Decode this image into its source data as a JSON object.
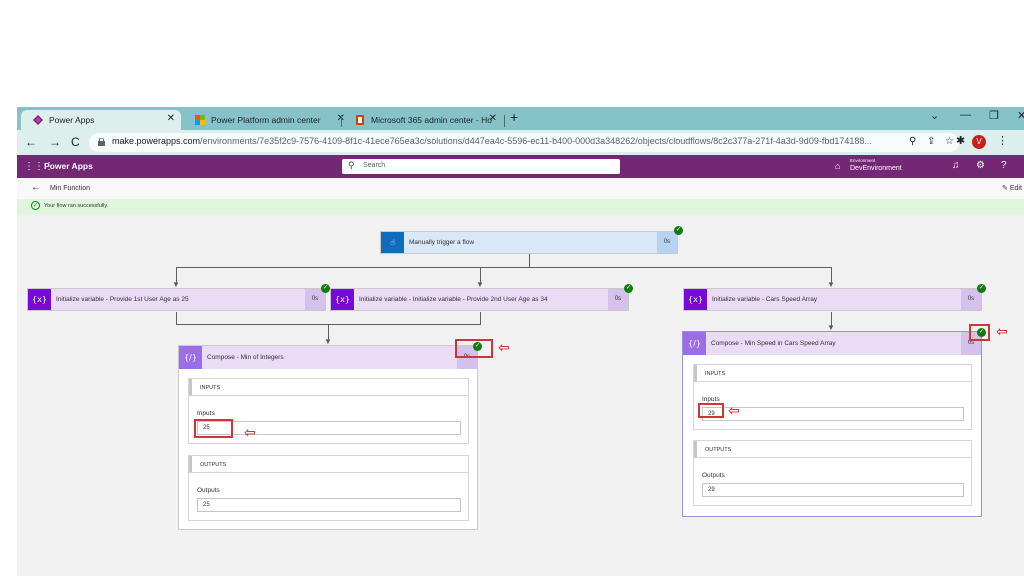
{
  "browser": {
    "tabs": [
      {
        "label": "Power Apps",
        "active": true
      },
      {
        "label": "Power Platform admin center",
        "active": false
      },
      {
        "label": "Microsoft 365 admin center - Ho",
        "active": false
      }
    ],
    "new_tab_icon": "plus-icon",
    "url_host": "make.powerapps.com",
    "url_path": "/environments/7e35f2c9-7576-4109-8f1c-41ece765ea3c/solutions/d447ea4c-5596-ec11-b400-000d3a348262/objects/cloudflows/8c2c377a-271f-4a3d-9d09-fbd174188...",
    "profile_initial": "V"
  },
  "app_header": {
    "title": "Power Apps",
    "search_placeholder": "Search",
    "environment_label": "Environment",
    "environment_name": "DevEnvironment"
  },
  "command_bar": {
    "flow_name": "Min Function",
    "edit_label": "Edit"
  },
  "banner": {
    "message": "Your flow ran successfully."
  },
  "flow": {
    "trigger": {
      "label": "Manually trigger a flow",
      "duration": "0s"
    },
    "variables": [
      {
        "icon": "{x}",
        "label": "Initialize variable - Provide 1st User Age as 25",
        "duration": "0s"
      },
      {
        "icon": "{x}",
        "label": "Initialize variable - Initialize variable - Provide 2nd User Age as 34",
        "duration": "0s"
      },
      {
        "icon": "{x}",
        "label": "Initialize variable - Cars Speed Array",
        "duration": "0s"
      }
    ],
    "compose_left": {
      "icon": "{/}",
      "label": "Compose - Min of Integers",
      "duration": "0s",
      "inputs_header": "INPUTS",
      "inputs_label": "Inputs",
      "inputs_value": "25",
      "outputs_header": "OUTPUTS",
      "outputs_label": "Outputs",
      "outputs_value": "25"
    },
    "compose_right": {
      "icon": "{/}",
      "label": "Compose - Min Speed in Cars Speed Array",
      "duration": "0s",
      "inputs_header": "INPUTS",
      "inputs_label": "Inputs",
      "inputs_value": "29",
      "outputs_header": "OUTPUTS",
      "outputs_label": "Outputs",
      "outputs_value": "29"
    }
  },
  "colors": {
    "app_header": "#742774",
    "variable_icon": "#770bd6",
    "trigger_icon": "#0f6cbd",
    "success": "#107c10",
    "annotation": "#d13438"
  }
}
